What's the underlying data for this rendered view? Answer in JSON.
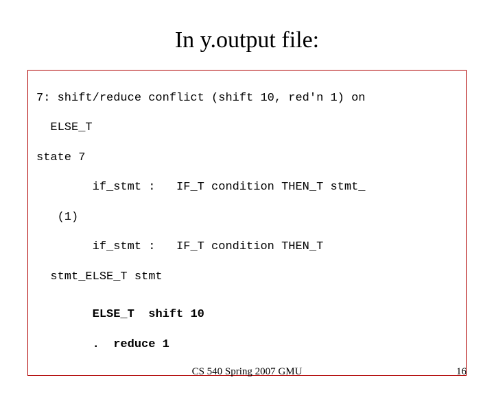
{
  "title": "In y.output file:",
  "code": {
    "l1": "7: shift/reduce conflict (shift 10, red'n 1) on",
    "l2": "  ELSE_T",
    "l3": "state 7",
    "l4": "        if_stmt :   IF_T condition THEN_T stmt_",
    "l5": "   (1)",
    "l6": "        if_stmt :   IF_T condition THEN_T",
    "l7": "  stmt_ELSE_T stmt",
    "b1": "        ELSE_T  shift 10",
    "b2": "        .  reduce 1"
  },
  "footer_center": "CS 540 Spring 2007 GMU",
  "footer_right": "16"
}
